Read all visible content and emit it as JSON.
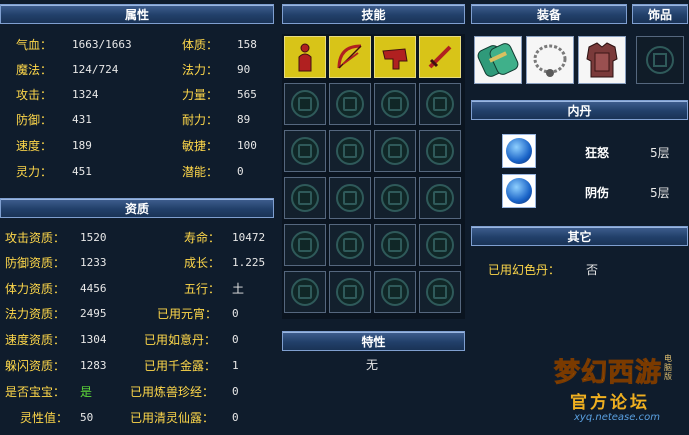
{
  "headers": {
    "attributes": "属性",
    "skills": "技能",
    "equipment": "装备",
    "accessory": "饰品",
    "aptitude": "资质",
    "neidan": "内丹",
    "traits": "特性",
    "other": "其它"
  },
  "attributes": {
    "left": [
      {
        "label": "气血：",
        "value": "1663/1663"
      },
      {
        "label": "魔法：",
        "value": "124/724"
      },
      {
        "label": "攻击：",
        "value": "1324"
      },
      {
        "label": "防御：",
        "value": "431"
      },
      {
        "label": "速度：",
        "value": "189"
      },
      {
        "label": "灵力：",
        "value": "451"
      }
    ],
    "right": [
      {
        "label": "体质：",
        "value": "158"
      },
      {
        "label": "法力：",
        "value": "90"
      },
      {
        "label": "力量：",
        "value": "565"
      },
      {
        "label": "耐力：",
        "value": "89"
      },
      {
        "label": "敏捷：",
        "value": "100"
      },
      {
        "label": "潜能：",
        "value": "0"
      }
    ]
  },
  "aptitude": {
    "left": [
      {
        "label": "攻击资质：",
        "value": "1520"
      },
      {
        "label": "防御资质：",
        "value": "1233"
      },
      {
        "label": "体力资质：",
        "value": "4456"
      },
      {
        "label": "法力资质：",
        "value": "2495"
      },
      {
        "label": "速度资质：",
        "value": "1304"
      },
      {
        "label": "躲闪资质：",
        "value": "1283"
      },
      {
        "label": "是否宝宝：",
        "value": "是"
      },
      {
        "label": "灵性值：",
        "value": "50"
      }
    ],
    "right": [
      {
        "label": "寿命：",
        "value": "10472"
      },
      {
        "label": "成长：",
        "value": "1.225"
      },
      {
        "label": "五行：",
        "value": "土"
      },
      {
        "label": "已用元宵：",
        "value": "0"
      },
      {
        "label": "已用如意丹：",
        "value": "0"
      },
      {
        "label": "已用千金露：",
        "value": "1"
      },
      {
        "label": "已用炼兽珍经：",
        "value": "0"
      },
      {
        "label": "已用清灵仙露：",
        "value": "0"
      }
    ]
  },
  "skills": {
    "icons": [
      "skill-icon-figure",
      "skill-icon-bow",
      "skill-icon-horn",
      "skill-icon-sword"
    ],
    "empty_slots": 20
  },
  "equipment": {
    "items": [
      "equipment-bracer-icon",
      "equipment-necklace-icon",
      "equipment-armor-icon"
    ],
    "accessory_slot": "empty-slot-emblem-icon"
  },
  "neidan": [
    {
      "name": "狂怒",
      "level": "5层"
    },
    {
      "name": "阴伤",
      "level": "5层"
    }
  ],
  "traits": {
    "value": "无"
  },
  "other": {
    "label": "已用幻色丹：",
    "value": "否"
  },
  "logo": {
    "line1": "梦幻西游",
    "line2": "官方论坛",
    "url": "xyq.netease.com",
    "badge": "电脑版"
  },
  "colors": {
    "label": "#ffd84a",
    "value": "#e8e8e8",
    "header_bg": "#22406a",
    "green": "#5fdc3a",
    "background": "#0f1c2c"
  }
}
